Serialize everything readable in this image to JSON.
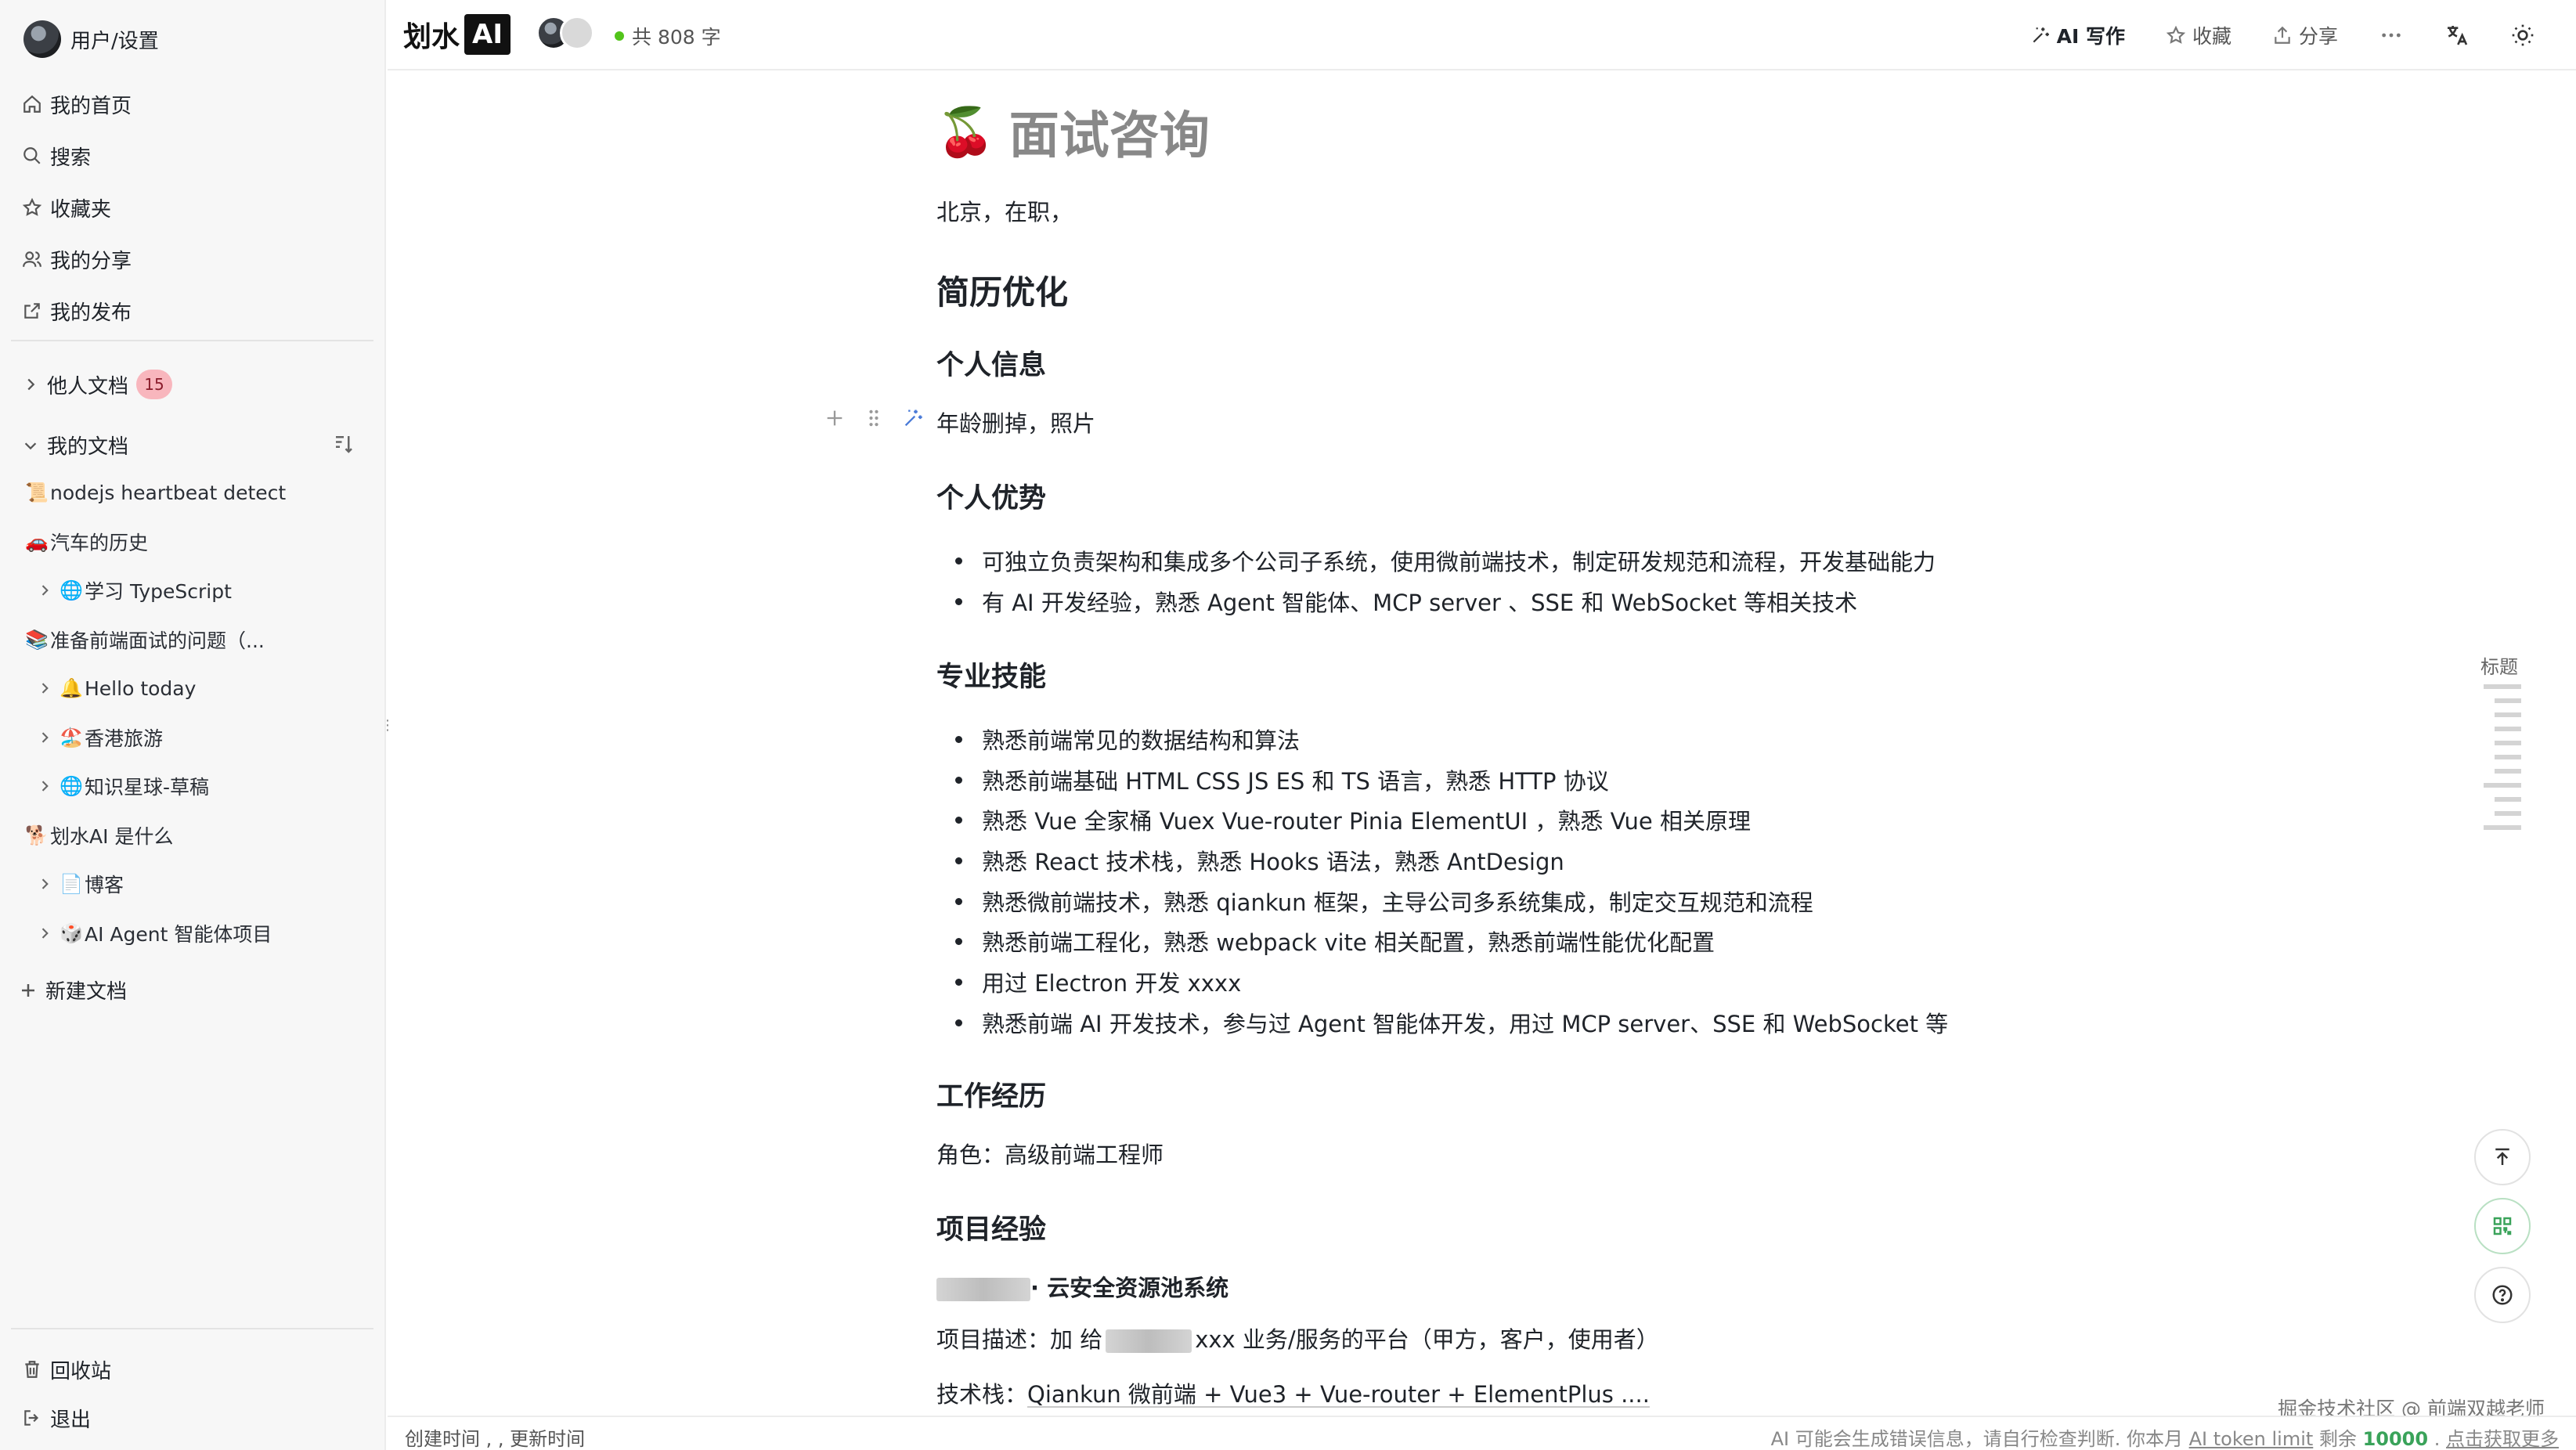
{
  "sidebar": {
    "user_label": "用户/设置",
    "nav": [
      {
        "icon": "home-icon",
        "label": "我的首页"
      },
      {
        "icon": "search-icon",
        "label": "搜索"
      },
      {
        "icon": "star-icon",
        "label": "收藏夹"
      },
      {
        "icon": "users-icon",
        "label": "我的分享"
      },
      {
        "icon": "external-link-icon",
        "label": "我的发布"
      }
    ],
    "others_label": "他人文档",
    "others_count": "15",
    "mine_label": "我的文档",
    "tree": [
      {
        "emoji": "📜",
        "label": "nodejs heartbeat detect",
        "arrow": false
      },
      {
        "emoji": "🚗",
        "label": "汽车的历史",
        "arrow": false
      },
      {
        "emoji": "🌐",
        "label": "学习 TypeScript",
        "arrow": true
      },
      {
        "emoji": "📚",
        "label": "准备前端面试的问题（...",
        "arrow": false
      },
      {
        "emoji": "🔔",
        "label": "Hello today",
        "arrow": true
      },
      {
        "emoji": "🏖️",
        "label": "香港旅游",
        "arrow": true
      },
      {
        "emoji": "🌐",
        "label": "知识星球-草稿",
        "arrow": true
      },
      {
        "emoji": "🐕",
        "label": "划水AI 是什么",
        "arrow": false
      },
      {
        "emoji": "📄",
        "label": "博客",
        "arrow": true
      },
      {
        "emoji": "🎲",
        "label": "AI Agent 智能体项目",
        "arrow": true
      }
    ],
    "new_doc_label": "新建文档",
    "recycle_label": "回收站",
    "logout_label": "退出"
  },
  "topbar": {
    "logo_text": "划水",
    "logo_ai": "AI",
    "word_count": "共 808 字",
    "ai_write_label": "AI 写作",
    "favorite_label": "收藏",
    "share_label": "分享"
  },
  "doc": {
    "title_emoji": "🍒",
    "title": "面试咨询",
    "intro": "北京，在职，",
    "h_resume": "简历优化",
    "h_personal_info": "个人信息",
    "personal_info": "年龄删掉，照片",
    "h_advantage": "个人优势",
    "advantages": [
      "可独立负责架构和集成多个公司子系统，使用微前端技术，制定研发规范和流程，开发基础能力",
      "有 AI 开发经验，熟悉 Agent 智能体、MCP server 、SSE 和 WebSocket 等相关技术"
    ],
    "h_skills": "专业技能",
    "skills": [
      "熟悉前端常见的数据结构和算法",
      "熟悉前端基础 HTML CSS JS ES 和 TS 语言，熟悉 HTTP 协议",
      "熟悉 Vue 全家桶 Vuex Vue-router Pinia ElementUI ，熟悉 Vue 相关原理",
      "熟悉 React 技术栈，熟悉 Hooks 语法，熟悉 AntDesign",
      "熟悉微前端技术，熟悉 qiankun 框架，主导公司多系统集成，制定交互规范和流程",
      "熟悉前端工程化，熟悉 webpack vite 相关配置，熟悉前端性能优化配置",
      "用过 Electron 开发 xxxx",
      "熟悉前端 AI 开发技术，参与过 Agent 智能体开发，用过 MCP server、SSE  和 WebSocket 等"
    ],
    "h_work": "工作经历",
    "role": "角色：高级前端工程师",
    "h_project": "项目经验",
    "project_name": "· 云安全资源池系统",
    "project_desc_prefix": "项目描述：加 给",
    "project_desc_suffix": "xxx 业务/服务的平台（甲方，客户，使用者）",
    "tech_stack_prefix": "技术栈：",
    "tech_stack": "Qiankun 微前端 + Vue3 + Vue-router + ElementPlus ...."
  },
  "right": {
    "toc_label": "标题",
    "watermark": "掘金技术社区 @ 前端双越老师"
  },
  "bottombar": {
    "created": "创建时间 , , 更新时间",
    "ai_note_prefix": "AI 可能会生成错误信息，请自行检查判断. 你本月",
    "ai_limit": "AI token limit",
    "ai_remain_prefix": "剩余",
    "ai_remain": "10000",
    "ai_more": "点击获取更多"
  }
}
